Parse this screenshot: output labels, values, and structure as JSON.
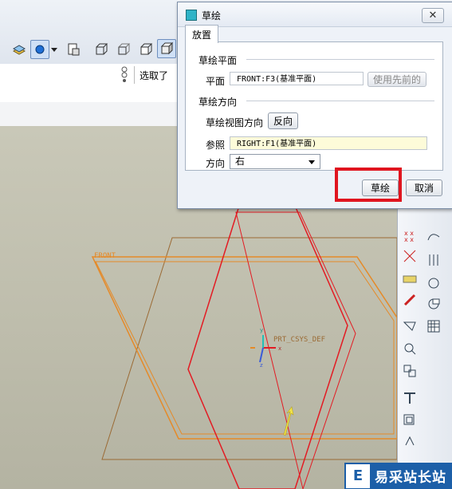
{
  "dialog": {
    "title": "草绘",
    "close_symbol": "✕",
    "tab_label": "放置",
    "sketch_plane": {
      "group_title": "草绘平面",
      "plane_label": "平面",
      "plane_value": "FRONT:F3(基准平面)",
      "use_previous_label": "使用先前的"
    },
    "orientation": {
      "group_title": "草绘方向",
      "view_dir_label": "草绘视图方向",
      "flip_label": "反向",
      "reference_label": "参照",
      "reference_value": "RIGHT:F1(基准平面)",
      "direction_label": "方向",
      "direction_value": "右"
    },
    "sketch_button": "草绘",
    "cancel_button": "取消"
  },
  "background": {
    "selection_label": "选取了",
    "front_plane_label": "FRONT",
    "csys_label": "PRT_CSYS_DEF",
    "csys_axis_labels": [
      "x",
      "y",
      "z"
    ]
  },
  "watermark": {
    "logo_letter": "E",
    "text": "易采站长站"
  },
  "colors": {
    "highlight": "#e0151f",
    "plane_orange": "#e58a28",
    "datum_red": "#e31b23",
    "viewport_bg": "#c3c2b1"
  },
  "icons": [
    "layers-icon",
    "display-style-icon",
    "saved-views-icon",
    "wireframe-icon",
    "hidden-line-icon",
    "no-hidden-icon",
    "shading-icon",
    "selection-filter-icon",
    "sketch-tool-icons"
  ]
}
